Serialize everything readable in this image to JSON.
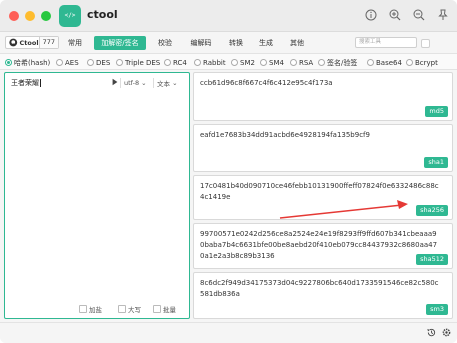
{
  "app": {
    "title": "ctool",
    "logo_text": "</>"
  },
  "titlebar_icons": [
    "info-icon",
    "zoom-in-icon",
    "zoom-out-icon",
    "pin-icon"
  ],
  "github": {
    "name": "Ctool",
    "stars": "777"
  },
  "tabs": [
    {
      "label": "常用",
      "active": false
    },
    {
      "label": "加解密/签名",
      "active": true
    },
    {
      "label": "校验",
      "active": false
    },
    {
      "label": "编解码",
      "active": false
    },
    {
      "label": "转换",
      "active": false
    },
    {
      "label": "生成",
      "active": false
    },
    {
      "label": "其他",
      "active": false
    }
  ],
  "search": {
    "placeholder": "搜索工具"
  },
  "algorithms": [
    {
      "label": "哈希(hash)",
      "checked": true
    },
    {
      "label": "AES",
      "checked": false
    },
    {
      "label": "DES",
      "checked": false
    },
    {
      "label": "Triple DES",
      "checked": false
    },
    {
      "label": "RC4",
      "checked": false
    },
    {
      "label": "Rabbit",
      "checked": false
    },
    {
      "label": "SM2",
      "checked": false
    },
    {
      "label": "SM4",
      "checked": false
    },
    {
      "label": "RSA",
      "checked": false
    },
    {
      "label": "签名/验签",
      "checked": false
    },
    {
      "label": "Base64",
      "checked": false
    },
    {
      "label": "Bcrypt",
      "checked": false
    }
  ],
  "input": {
    "value": "王者荣耀",
    "encoding": "utf-8",
    "type": "文本",
    "options": [
      "加盐",
      "大写",
      "批量"
    ]
  },
  "results": [
    {
      "algo": "md5",
      "hash": "ccb61d96c8f667c4f6c412e95c4f173a"
    },
    {
      "algo": "sha1",
      "hash": "eafd1e7683b34dd91acbd6e4928194fa135b9cf9"
    },
    {
      "algo": "sha256",
      "hash": "17c0481b40d090710ce46febb10131900ffeff07824f0e6332486c88c4c1419e"
    },
    {
      "algo": "sha512",
      "hash": "99700571e0242d256ce8a2524e24e19f8293ff9ffd607b341cbeaaa90baba7b4c6631bfe00be8aebd20f410eb079cc84437932c8680aa470a1e2a3b8c89b3136"
    },
    {
      "algo": "sm3",
      "hash": "8c6dc2f949d34175373d04c9227806bc640d1733591546ce82c580c581db836a"
    }
  ],
  "colors": {
    "accent": "#2fb892",
    "arrow": "#e53935"
  }
}
